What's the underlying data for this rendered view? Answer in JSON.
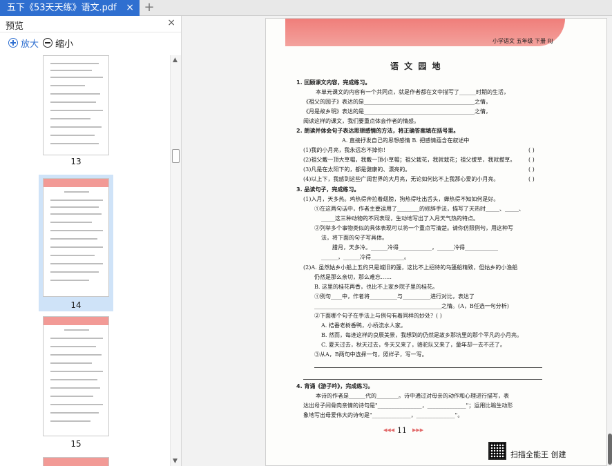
{
  "tab": {
    "title": "五下《53天天练》语文.pdf",
    "close": "×",
    "add": "+"
  },
  "sidebar": {
    "title": "预览",
    "close": "×",
    "zoom_in": "放大",
    "zoom_out": "缩小",
    "thumbnails": [
      {
        "label": "13"
      },
      {
        "label": "14",
        "selected": true
      },
      {
        "label": "15"
      }
    ]
  },
  "page": {
    "header": "小学语文  五年级  下册  RJ",
    "section_title": "语 文 园 地",
    "lines": [
      "1. 回顾课文内容，完成练习。",
      "本单元课文的内容有一个共同点，就是作者都在文中描写了______时期的生活，",
      "《祖父的园子》表达的是________________________________________之情，",
      "《月是故乡明》表达的是________________________________________之情，",
      "阅读这样的课文，我们要重点体会作者的情感。",
      "2. 朗读并体会句子表达思想感情的方法，将正确答案填在括号里。",
      "A. 直接抒发自己的思想感情          B. 把感情蕴含在叙述中",
      "(1)我的小月亮，我永远忘不掉你！",
      "(2)祖父戴一顶大草帽，我戴一顶小草帽；祖父栽花，我就栽花；祖父拔草，我就拔草。",
      "(3)凡是在太阳下的，都是健康的、漂亮的。",
      "(4)以上下，我感到这些广阔世界的大月亮，无论如何比不上我那心爱的小月亮。",
      "3. 品读句子，完成练习。",
      "(1)入月，天多热。鸡热得奔拉着翅膀，狗热得吐出舌头，蝉热得不知如何是好。",
      "①在这两句话中，作者主要运用了________的修辞手法，描写了天热时_____、_____、",
      "_____这三种动物的不同表现，生动地写出了入月天气热的特点。",
      "②列举多个事物类似的具体表现可以将一个重点写清楚。请你仿照例句，用这种写",
      "法，将下面的句子写具体。",
      "腊月，天多冷。______冷得____________，______冷得____________",
      "______，______冷得____________。",
      "(2)A. 虽然姑乡小船上五约只是城旧的篷，这比不上招待的乌篷船精致，但姑乡的小渔船",
      "仍然是那么亲切，那么难忘……",
      "B. 这里的桂花再香，也比不上家乡院子里的桂花。",
      "①例句____中，作者将__________与__________进行对比，表达了",
      "______________________________________________之情。(A，B任选一句分析)",
      "②下面哪个句子在手法上与例句有着同样的妙处？(     )",
      "A. 桔番老树香鸭，小桥流水人家。",
      "B. 然而，每逢这样的良辰美景，我想到的仍然是故乡那坑里的那个平凡的小月亮。",
      "C. 夏天过去，秋天过去，冬天又来了，骆驼队又来了，童年却一去不还了。",
      "③从A，B两句中选择一句，照样子，写一写。",
      "4. 背诵《游子吟》，完成练习。",
      "本诗的作者是______代的________。诗中通过对母亲的动作和心理进行描写，表",
      "达出母子间骨肉亲情的诗句是\"________________，______________\"；运用比喻生动形",
      "象地写出母爱伟大的诗句是\"______________，______________\"。"
    ],
    "brackets": [
      "(    )",
      "(    )",
      "(    )",
      "(    )"
    ],
    "page_number": "11",
    "watermark": "扫描全能王  创建"
  },
  "colors": {
    "tab": "#2f6fd0",
    "banner": "#f07e7a",
    "selection": "#cfe3f8"
  }
}
